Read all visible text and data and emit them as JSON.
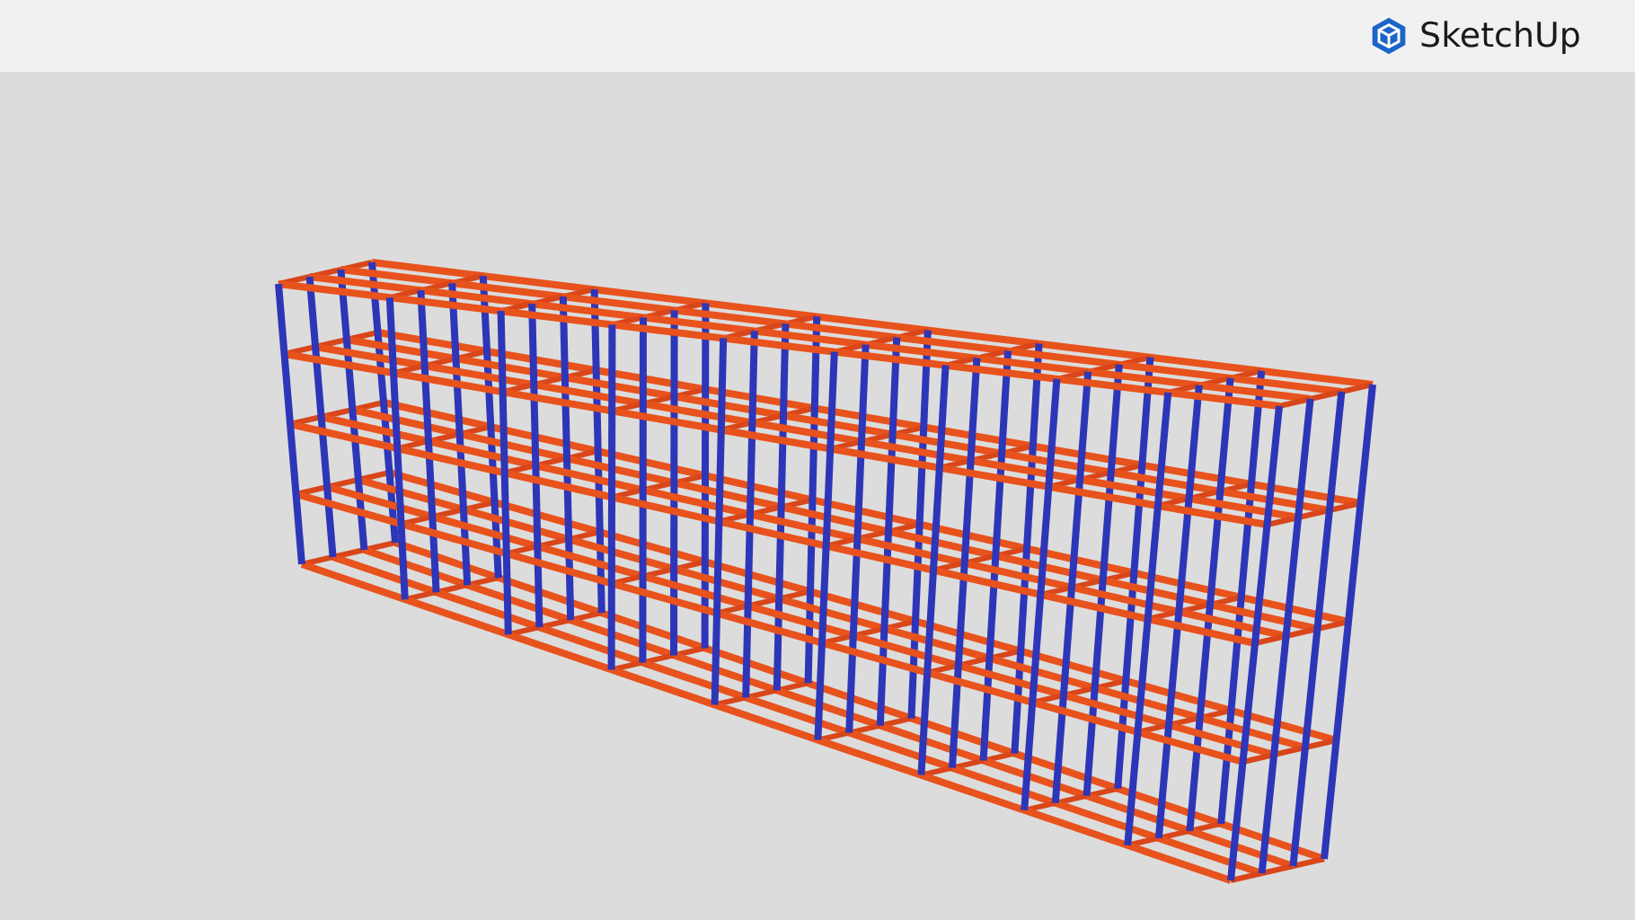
{
  "header": {
    "brand": "SketchUp"
  }
}
